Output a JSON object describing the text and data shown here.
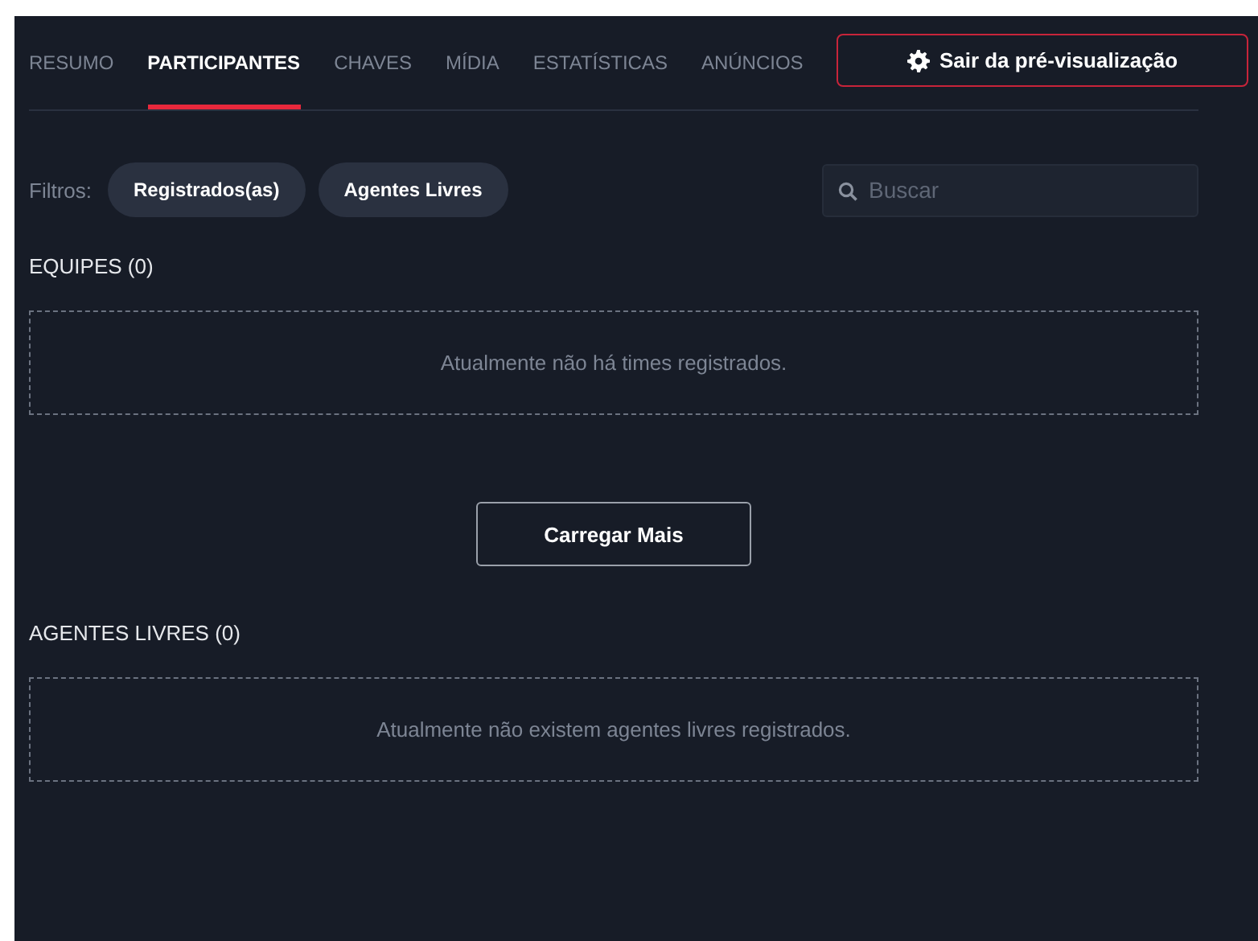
{
  "tabs": [
    {
      "label": "RESUMO",
      "selected": false
    },
    {
      "label": "PARTICIPANTES",
      "selected": true
    },
    {
      "label": "CHAVES",
      "selected": false
    },
    {
      "label": "MÍDIA",
      "selected": false
    },
    {
      "label": "ESTATÍSTICAS",
      "selected": false
    },
    {
      "label": "ANÚNCIOS",
      "selected": false
    }
  ],
  "exit_preview_button": {
    "label": "Sair da pré-visualização"
  },
  "filters": {
    "label": "Filtros:",
    "options": [
      "Registrados(as)",
      "Agentes Livres"
    ]
  },
  "search": {
    "placeholder": "Buscar"
  },
  "sections": [
    {
      "heading": "EQUIPES (0)",
      "empty_message": "Atualmente não há times registrados.",
      "load_more": "Carregar Mais"
    },
    {
      "heading": "AGENTES LIVRES (0)",
      "empty_message": "Atualmente não existem agentes livres registrados."
    }
  ]
}
